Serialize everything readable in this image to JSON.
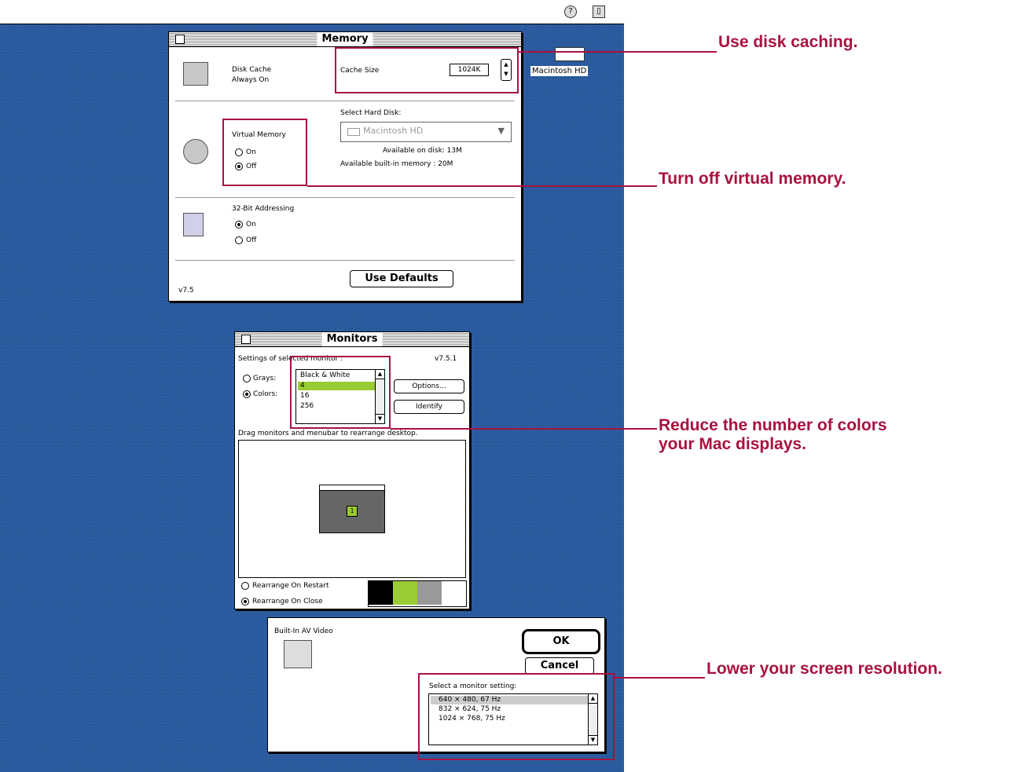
{
  "colors": {
    "accent": "#a8123f",
    "desktop": "#2a5a9e",
    "highlight": "#99cc33"
  },
  "menubar": {
    "help_icon": "question-icon",
    "app_icon": "finder-icon",
    "help_glyph": "?",
    "app_glyph": "▯"
  },
  "hd_label": "Macintosh HD",
  "memory": {
    "title": "Memory",
    "disk_cache_label": "Disk Cache",
    "disk_cache_state": "Always On",
    "cache_size_label": "Cache Size",
    "cache_size_value": "1024K",
    "select_hd_label": "Select Hard Disk:",
    "hd_popup_value": "Macintosh HD",
    "vm_label": "Virtual Memory",
    "vm_on": "On",
    "vm_off": "Off",
    "available_disk": "Available on disk:  13M",
    "available_mem": "Available built-in memory :  20M",
    "addr_label": "32-Bit Addressing",
    "addr_on": "On",
    "addr_off": "Off",
    "defaults_button": "Use Defaults",
    "version": "v7.5"
  },
  "monitors": {
    "title": "Monitors",
    "settings_label": "Settings of selected monitor :",
    "version": "v7.5.1",
    "grays": "Grays:",
    "colors": "Colors:",
    "depths": [
      "Black & White",
      "4",
      "16",
      "256"
    ],
    "selected_depth": "4",
    "options_button": "Options...",
    "identify_button": "Identify",
    "drag_label": "Drag monitors and menubar to rearrange desktop.",
    "monitor_number": "1",
    "rearrange_restart": "Rearrange On Restart",
    "rearrange_close": "Rearrange On Close"
  },
  "video": {
    "name": "Built-In AV Video",
    "ok": "OK",
    "cancel": "Cancel",
    "select_label": "Select a monitor setting:",
    "settings": [
      "640 × 480, 67 Hz",
      "832 × 624, 75 Hz",
      "1024 × 768, 75 Hz"
    ]
  },
  "callouts": {
    "disk": "Use disk caching.",
    "vm": "Turn off virtual memory.",
    "colors_1": "Reduce the number of colors",
    "colors_2": "your Mac displays.",
    "resolution": "Lower your screen resolution."
  }
}
